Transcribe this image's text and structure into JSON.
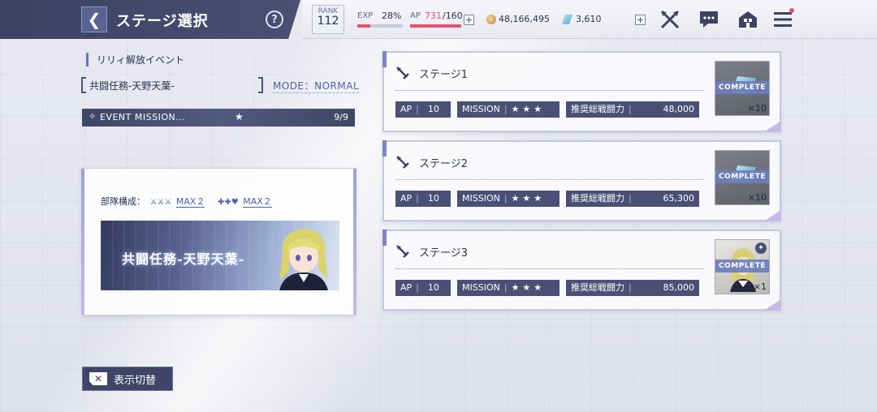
{
  "header": {
    "title": "ステージ選択",
    "back_icon": "chevron-left-icon",
    "help_label": "?",
    "rank_label": "RANK",
    "rank_value": "112",
    "exp_label": "EXP",
    "exp_percent": "28%",
    "exp_progress": 0.28,
    "ap_label": "AP",
    "ap_current": "731",
    "ap_max": "/160",
    "plus_label": "+",
    "coins": "48,166,495",
    "gems": "3,610"
  },
  "event": {
    "label": "リリィ解放イベント",
    "mission_name": "共闘任務-天野天葉-",
    "mode": "MODE：NORMAL",
    "event_mission_label": "EVENT MISSION...",
    "event_mission_count": "9/9"
  },
  "party": {
    "composition_label": "部隊構成：",
    "group1_max": "MAX２",
    "group2_max": "MAX２",
    "banner_title": "共闘任務-天野天葉-"
  },
  "switch_label": "表示切替",
  "stages": [
    {
      "name": "ステージ1",
      "ap_label": "AP",
      "ap": "10",
      "mission_label": "MISSION",
      "stars": "★★★",
      "power_label": "推奨総戦闘力",
      "power": "48,000",
      "complete": "COMPLETE",
      "qty": "×10",
      "reward": "gem"
    },
    {
      "name": "ステージ2",
      "ap_label": "AP",
      "ap": "10",
      "mission_label": "MISSION",
      "stars": "★★★",
      "power_label": "推奨総戦闘力",
      "power": "65,300",
      "complete": "COMPLETE",
      "qty": "×10",
      "reward": "gem"
    },
    {
      "name": "ステージ3",
      "ap_label": "AP",
      "ap": "10",
      "mission_label": "MISSION",
      "stars": "★★★",
      "power_label": "推奨総戦闘力",
      "power": "85,000",
      "complete": "COMPLETE",
      "qty": "×1",
      "reward": "character"
    }
  ]
}
